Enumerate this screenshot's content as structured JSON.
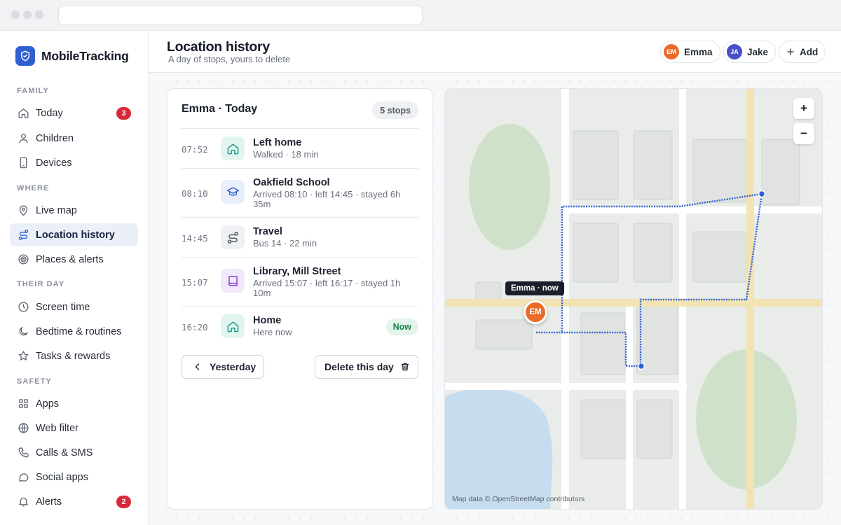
{
  "app": {
    "name": "MobileTracking",
    "brand_color": "#2f5fd0"
  },
  "sidebar": {
    "sections": {
      "family": "FAMILY",
      "where": "WHERE",
      "their_day": "THEIR DAY",
      "safety": "SAFETY"
    },
    "items": [
      {
        "label": "Today",
        "icon": "home-icon",
        "badge": "3"
      },
      {
        "label": "Children",
        "icon": "user-icon"
      },
      {
        "label": "Devices",
        "icon": "phone-icon"
      },
      {
        "label": "Live map",
        "icon": "pin-icon"
      },
      {
        "label": "Location history",
        "icon": "route-icon",
        "active": true
      },
      {
        "label": "Places & alerts",
        "icon": "target-icon"
      },
      {
        "label": "Screen time",
        "icon": "clock-icon"
      },
      {
        "label": "Bedtime & routines",
        "icon": "moon-icon"
      },
      {
        "label": "Tasks & rewards",
        "icon": "star-icon"
      },
      {
        "label": "Apps",
        "icon": "grid-icon"
      },
      {
        "label": "Web filter",
        "icon": "globe-icon"
      },
      {
        "label": "Calls & SMS",
        "icon": "phone-call-icon"
      },
      {
        "label": "Social apps",
        "icon": "chat-icon"
      },
      {
        "label": "Alerts",
        "icon": "bell-icon",
        "badge": "2"
      }
    ]
  },
  "header": {
    "title": "Location history",
    "subtitle": "A day of stops, yours to delete",
    "people": [
      {
        "initials": "EM",
        "name": "Emma",
        "color": "#e96c2a"
      },
      {
        "initials": "JA",
        "name": "Jake",
        "color": "#4a4fc9"
      }
    ],
    "add_label": "Add"
  },
  "timeline": {
    "title": "Emma · Today",
    "count_label": "5 stops",
    "stops": [
      {
        "time": "07:52",
        "title": "Left home",
        "detail": "Walked · 18 min",
        "icon": "home-icon",
        "tone": "teal"
      },
      {
        "time": "08:10",
        "title": "Oakfield School",
        "detail": "Arrived 08:10 · left 14:45 · stayed 6h 35m",
        "icon": "graduation-cap-icon",
        "tone": "blue"
      },
      {
        "time": "14:45",
        "title": "Travel",
        "detail": "Bus 14 · 22 min",
        "icon": "route-icon",
        "tone": "gray"
      },
      {
        "time": "15:07",
        "title": "Library, Mill Street",
        "detail": "Arrived 15:07 · left 16:17 · stayed 1h 10m",
        "icon": "book-icon",
        "tone": "purple"
      },
      {
        "time": "16:20",
        "title": "Home",
        "detail": "Here now",
        "icon": "home-icon",
        "tone": "teal",
        "status": "Now"
      }
    ],
    "prev_label": "Yesterday",
    "delete_label": "Delete this day"
  },
  "map": {
    "marker_label": "Emma · now",
    "marker_initials": "EM",
    "zoom_in": "+",
    "zoom_out": "−",
    "attribution": "Map data © OpenStreetMap contributors"
  }
}
